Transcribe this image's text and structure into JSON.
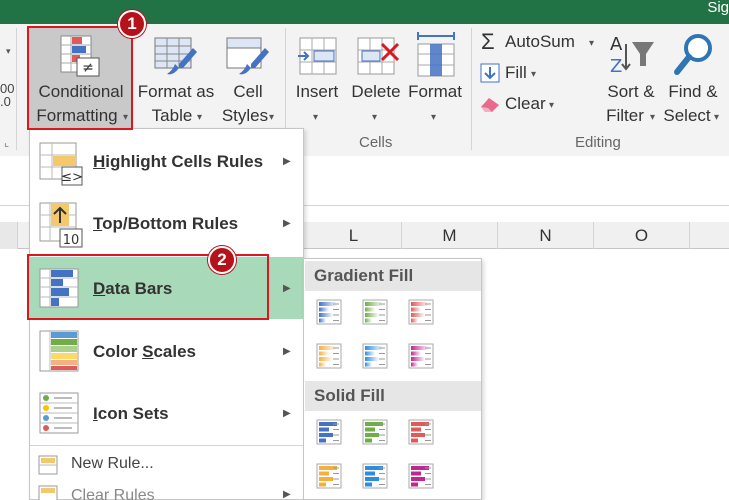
{
  "title_fragment": "Sig",
  "ribbon": {
    "conditional_formatting": {
      "line1": "Conditional",
      "line2": "Formatting"
    },
    "format_as_table": {
      "line1": "Format as",
      "line2": "Table"
    },
    "cell_styles": {
      "line1": "Cell",
      "line2": "Styles"
    },
    "insert": "Insert",
    "delete": "Delete",
    "format": "Format",
    "cells_group": "Cells",
    "autosum": "AutoSum",
    "fill": "Fill",
    "clear": "Clear",
    "sort_filter": {
      "line1": "Sort &",
      "line2": "Filter"
    },
    "find_select": {
      "line1": "Find &",
      "line2": "Select"
    },
    "editing_group": "Editing",
    "number_fragment": "00\n.0"
  },
  "columns": [
    "L",
    "M",
    "N",
    "O"
  ],
  "menu": {
    "items": [
      {
        "label": "Highlight Cells Rules",
        "key": "H"
      },
      {
        "label": "Top/Bottom Rules",
        "key": "T"
      },
      {
        "label": "Data Bars",
        "key": "D"
      },
      {
        "label": "Color Scales",
        "key": "S"
      },
      {
        "label": "Icon Sets",
        "key": "I"
      }
    ],
    "new_rule": "New Rule...",
    "clear_rules": "Clear Rules"
  },
  "submenu": {
    "gradient_fill": "Gradient Fill",
    "solid_fill": "Solid Fill",
    "bar_colors": [
      "#4472c4",
      "#70ad47",
      "#e05a5a",
      "#f4b03e",
      "#2e8de0",
      "#c0278f"
    ]
  },
  "callouts": [
    "1",
    "2"
  ]
}
